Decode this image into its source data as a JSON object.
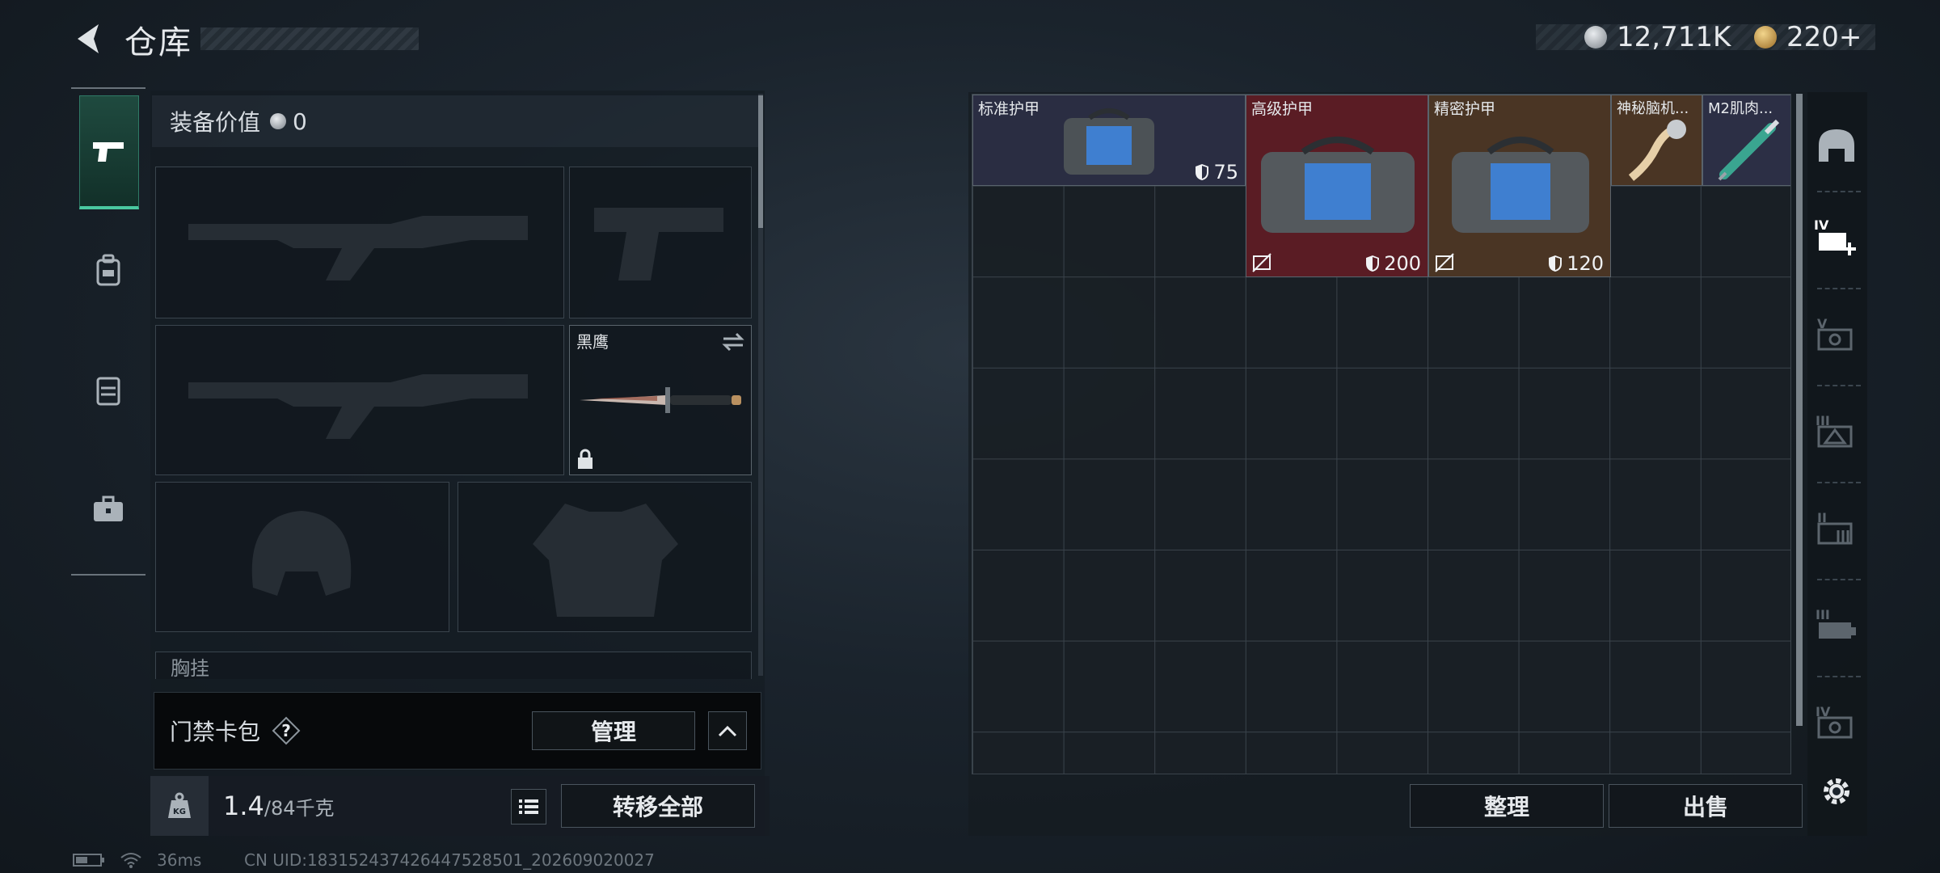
{
  "header": {
    "title": "仓库"
  },
  "currency": {
    "silver": "12,711K",
    "gold": "220+"
  },
  "left_tabs": [
    {
      "name": "weapons",
      "icon": "pistol-icon",
      "active": true
    },
    {
      "name": "backpack",
      "icon": "backpack-icon",
      "active": false
    },
    {
      "name": "vest",
      "icon": "vest-icon",
      "active": false
    },
    {
      "name": "case",
      "icon": "briefcase-icon",
      "active": false
    }
  ],
  "equipment": {
    "value_label": "装备价值",
    "value": "0",
    "knife_label": "黑鹰",
    "chest_label": "胸挂"
  },
  "keycard": {
    "label": "门禁卡包",
    "help": "?",
    "manage": "管理"
  },
  "weight": {
    "current": "1.4",
    "max": "/84千克",
    "unit_icon": "KG"
  },
  "actions": {
    "transfer_all": "转移全部",
    "sort": "整理",
    "sell": "出售"
  },
  "status": {
    "ping": "36ms",
    "uid": "CN UID:18315243742644752850​1_202609020027"
  },
  "stash_items": [
    {
      "name": "标准护甲",
      "durability": "75"
    },
    {
      "name": "高级护甲",
      "durability": "200"
    },
    {
      "name": "精密护甲",
      "durability": "120"
    },
    {
      "name": "神秘脑机...",
      "durability": ""
    },
    {
      "name": "M2肌肉...",
      "durability": ""
    }
  ],
  "right_rail": [
    "helmet-icon",
    "case-iv-icon",
    "case-v-icon",
    "case-iii-icon",
    "case-ii-icon",
    "case-iii-b-icon",
    "case-iv-b-icon",
    "settings-icon"
  ],
  "colors": {
    "accent": "#49c8a0",
    "rare_red": "#5a1a22",
    "rare_gold": "#4a3522",
    "std": "#2c2f45"
  }
}
